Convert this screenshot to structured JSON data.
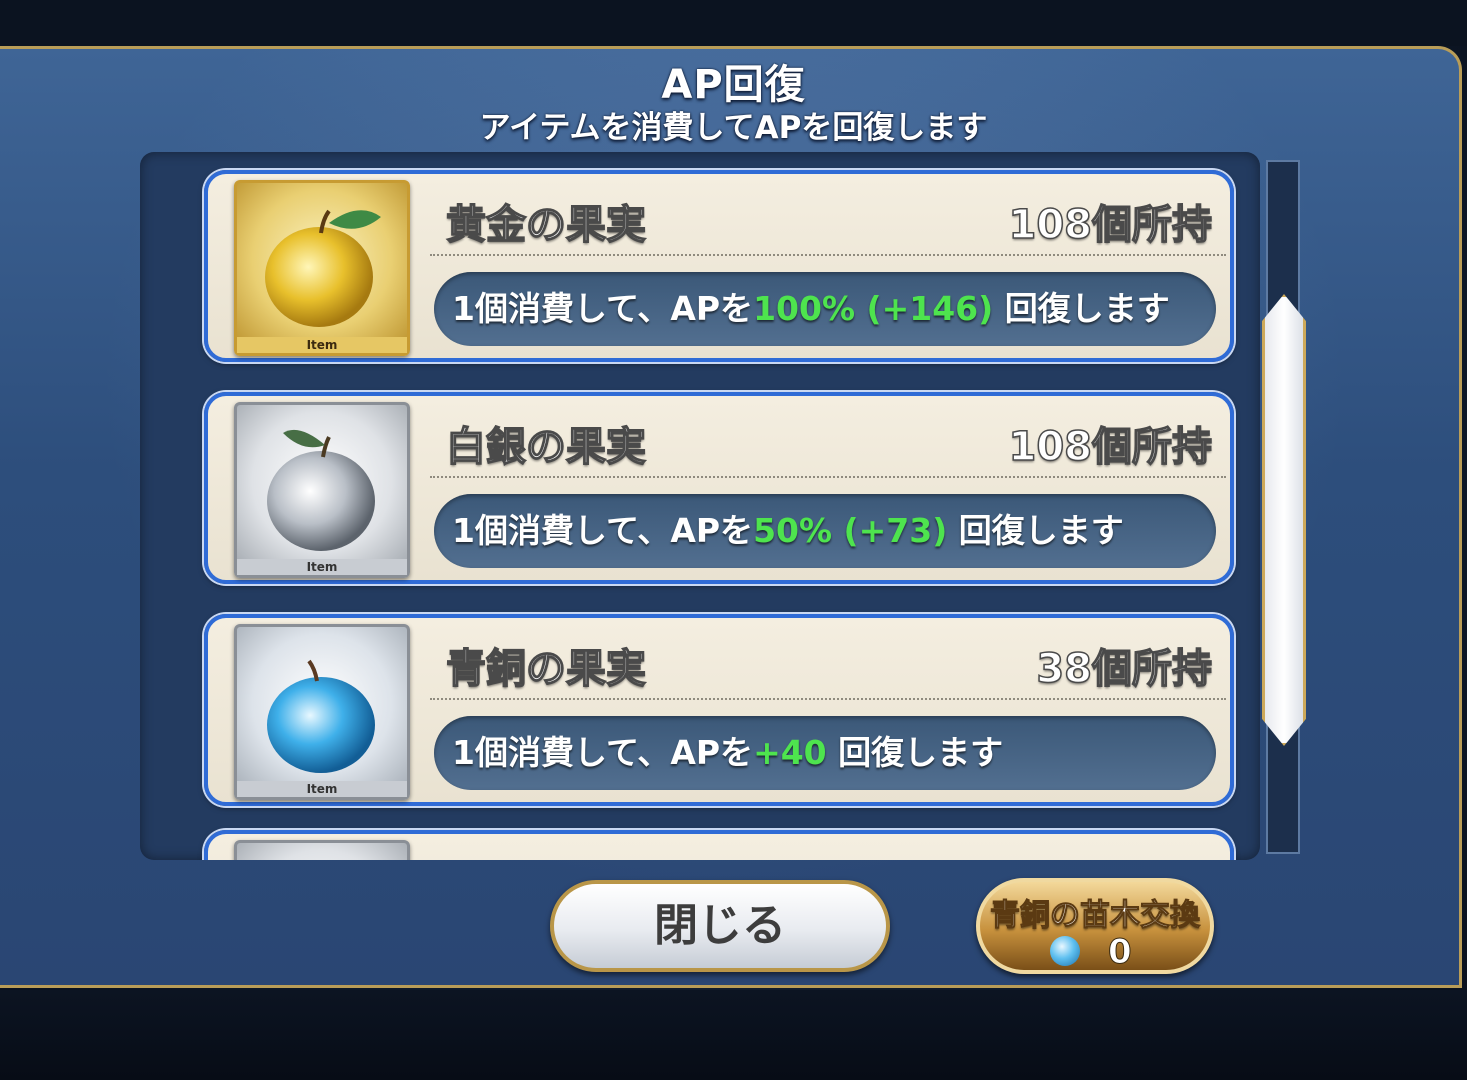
{
  "header": {
    "title": "AP回復",
    "subtitle": "アイテムを消費してAPを回復します"
  },
  "items": [
    {
      "name": "黄金の果実",
      "count": "108個所持",
      "tag": "Item",
      "desc_prefix": "1個消費して、APを",
      "desc_highlight": "100% (+146)",
      "desc_suffix": " 回復します",
      "icon": "gold-apple-icon",
      "color": "#e8c440"
    },
    {
      "name": "白銀の果実",
      "count": "108個所持",
      "tag": "Item",
      "desc_prefix": "1個消費して、APを",
      "desc_highlight": "50% (+73)",
      "desc_suffix": " 回復します",
      "icon": "silver-apple-icon",
      "color": "#c9ced6"
    },
    {
      "name": "青銅の果実",
      "count": "38個所持",
      "tag": "Item",
      "desc_prefix": "1個消費して、APを",
      "desc_highlight": "+40",
      "desc_suffix": " 回復します",
      "icon": "bronze-apple-icon",
      "color": "#4fb8ec"
    }
  ],
  "footer": {
    "close_label": "閉じる",
    "exchange_label": "青銅の苗木交換",
    "exchange_count": "0",
    "exchange_icon": "blue-seedling-icon"
  },
  "colors": {
    "highlight": "#4ee44e",
    "item_border": "#2f6bd6",
    "gold_trim": "#b99d58"
  }
}
